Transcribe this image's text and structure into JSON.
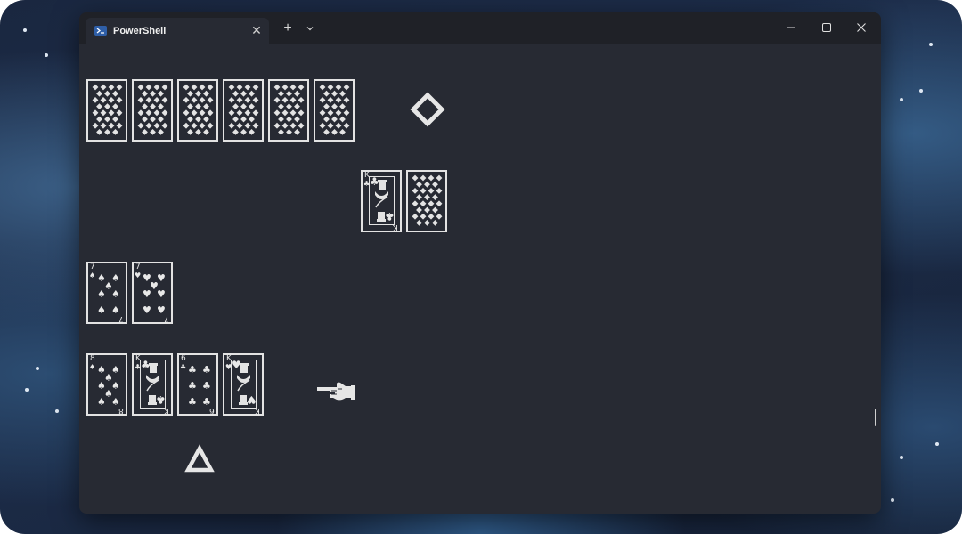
{
  "window": {
    "tab_title": "PowerShell",
    "new_tab_label": "+",
    "tab_menu_label": "⌄",
    "close_tab_label": "✕"
  },
  "colors": {
    "terminal_bg": "#272a33",
    "titlebar_bg": "#1f2127",
    "card_line": "#e3e3e3"
  },
  "game": {
    "stock_pile": {
      "face_down_count": 6
    },
    "indicator_top": "◇",
    "dealer_hand": [
      {
        "rank": "K",
        "suit": "♣",
        "face_up": true
      },
      {
        "face_up": false
      }
    ],
    "split_hand": [
      {
        "rank": "7",
        "suit": "♠",
        "face_up": true
      },
      {
        "rank": "7",
        "suit": "♥",
        "face_up": true
      }
    ],
    "player_hand": [
      {
        "rank": "8",
        "suit": "♠",
        "face_up": true
      },
      {
        "rank": "K",
        "suit": "♣",
        "face_up": true
      },
      {
        "rank": "6",
        "suit": "♣",
        "face_up": true
      },
      {
        "rank": "K",
        "suit": "♥",
        "face_up": true
      }
    ],
    "pointer_hand": "☜",
    "indicator_bottom": "△"
  }
}
